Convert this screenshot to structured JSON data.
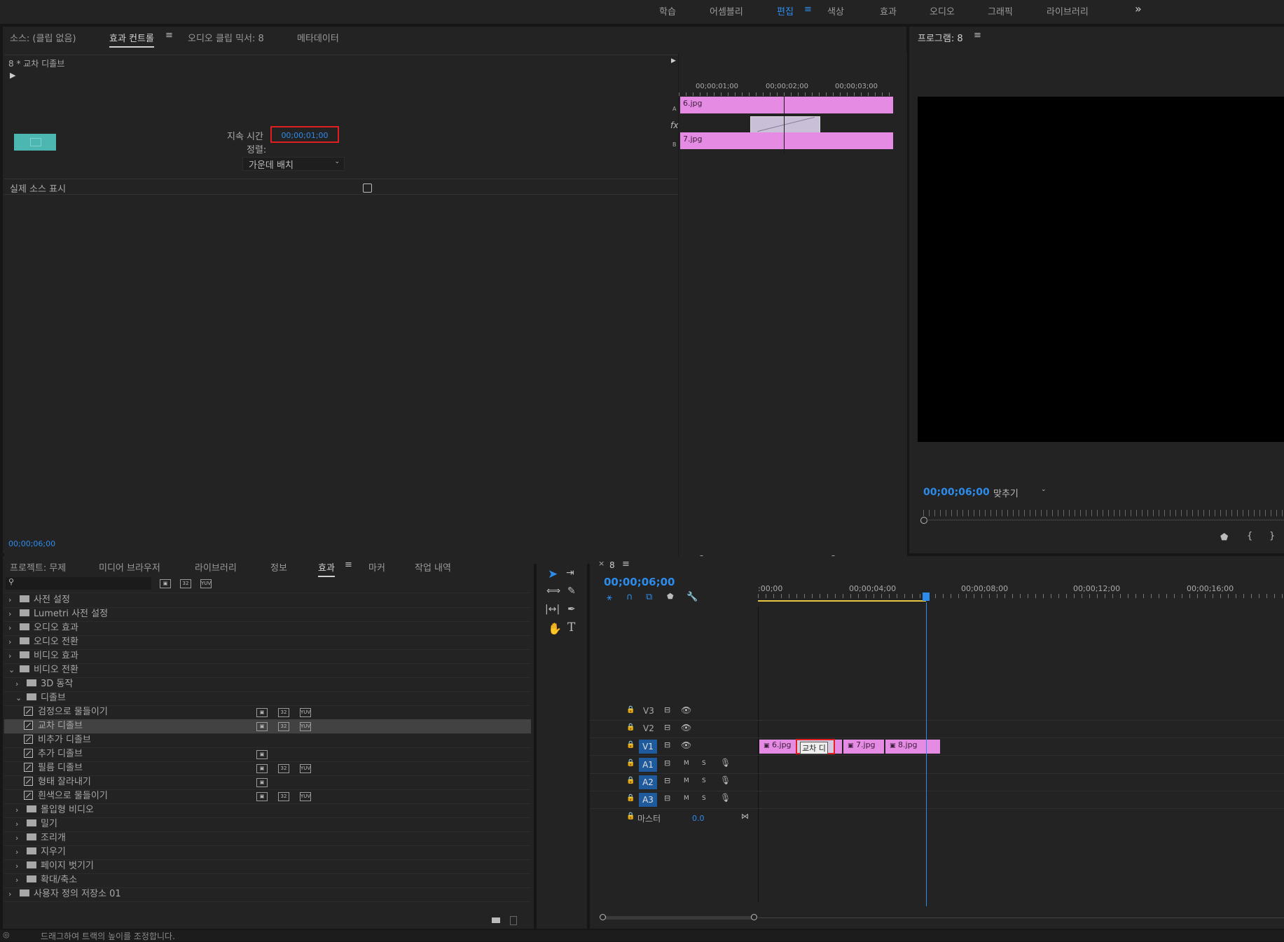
{
  "workspaces": {
    "items": [
      "학습",
      "어셈블리",
      "편집",
      "색상",
      "효과",
      "오디오",
      "그래픽",
      "라이브러리"
    ],
    "active": "편집",
    "more": "»"
  },
  "source_panel": {
    "tabs": [
      "소스: (클립 없음)",
      "효과 컨트롤",
      "오디오 클립 믹서: 8",
      "메타데이터"
    ],
    "active_tab": "효과 컨트롤",
    "clip_title": "8 * 교차 디졸브",
    "duration_label": "지속 시간",
    "duration_value": "00;00;01;00",
    "alignment_label": "정렬:",
    "alignment_value": "가운데 배치",
    "show_actual_sources": "실제 소스 표시",
    "timecode": "00;00;06;00",
    "mini_timeline": {
      "ticks": [
        "00;00;01;00",
        "00;00;02;00",
        "00;00;03;00"
      ],
      "clip_a": "6.jpg",
      "clip_b": "7.jpg",
      "track_a": "A",
      "track_b": "B",
      "fx": "fx"
    }
  },
  "program_monitor": {
    "title": "프로그램: 8",
    "timecode": "00;00;06;00",
    "zoom": "맞추기"
  },
  "project_panel": {
    "tabs": [
      "프로젝트: 무제",
      "미디어 브라우저",
      "라이브러리",
      "정보",
      "효과",
      "마커",
      "작업 내역"
    ],
    "active_tab": "효과",
    "search_placeholder": "",
    "tree": [
      {
        "label": "사전 설정",
        "level": 0,
        "type": "preset"
      },
      {
        "label": "Lumetri 사전 설정",
        "level": 0,
        "type": "preset"
      },
      {
        "label": "오디오 효과",
        "level": 0,
        "type": "folder"
      },
      {
        "label": "오디오 전환",
        "level": 0,
        "type": "folder"
      },
      {
        "label": "비디오 효과",
        "level": 0,
        "type": "folder"
      },
      {
        "label": "비디오 전환",
        "level": 0,
        "type": "folder-open"
      },
      {
        "label": "3D 동작",
        "level": 1,
        "type": "folder"
      },
      {
        "label": "디졸브",
        "level": 1,
        "type": "folder-open"
      },
      {
        "label": "검정으로 물들이기",
        "level": 2,
        "type": "effect",
        "badges": 3
      },
      {
        "label": "교차 디졸브",
        "level": 2,
        "type": "effect",
        "badges": 3,
        "selected": true
      },
      {
        "label": "비추가 디졸브",
        "level": 2,
        "type": "effect",
        "badges": 0
      },
      {
        "label": "추가 디졸브",
        "level": 2,
        "type": "effect",
        "badges": 1
      },
      {
        "label": "필름 디졸브",
        "level": 2,
        "type": "effect",
        "badges": 3
      },
      {
        "label": "형태 잘라내기",
        "level": 2,
        "type": "effect",
        "badges": 1
      },
      {
        "label": "흰색으로 물들이기",
        "level": 2,
        "type": "effect",
        "badges": 3
      },
      {
        "label": "몰입형 비디오",
        "level": 1,
        "type": "folder"
      },
      {
        "label": "밀기",
        "level": 1,
        "type": "folder"
      },
      {
        "label": "조리개",
        "level": 1,
        "type": "folder"
      },
      {
        "label": "지우기",
        "level": 1,
        "type": "folder"
      },
      {
        "label": "페이지 벗기기",
        "level": 1,
        "type": "folder"
      },
      {
        "label": "확대/축소",
        "level": 1,
        "type": "folder"
      },
      {
        "label": "사용자 정의 저장소 01",
        "level": 0,
        "type": "folder"
      }
    ]
  },
  "timeline": {
    "sequence_name": "8",
    "timecode": "00;00;06;00",
    "ruler": [
      ":00;00",
      "00;00;04;00",
      "00;00;08;00",
      "00;00;12;00",
      "00;00;16;00"
    ],
    "video_tracks": [
      "V3",
      "V2",
      "V1"
    ],
    "audio_tracks": [
      "A1",
      "A2",
      "A3"
    ],
    "master_label": "마스터",
    "master_value": "0.0",
    "mute": "M",
    "solo": "S",
    "clips": [
      "6.jpg",
      "7.jpg",
      "8.jpg"
    ],
    "transition": "교차 디"
  },
  "status_bar": {
    "text": "드래그하여 트랙의 높이를 조정합니다."
  },
  "colors": {
    "accent_blue": "#2d8ceb",
    "clip_pink": "#e58be3",
    "highlight_red": "#e02020",
    "target_blue": "#1e5a9c"
  }
}
